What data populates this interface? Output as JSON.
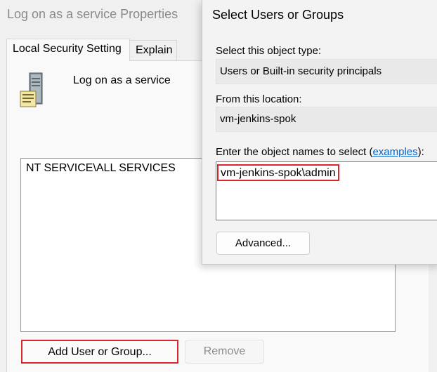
{
  "properties_window": {
    "title": "Log on as a service Properties",
    "tabs": [
      {
        "label": "Local Security Setting",
        "active": true
      },
      {
        "label": "Explain",
        "active": false
      }
    ],
    "policy_icon": "server-policy-icon",
    "policy_name": "Log on as a service",
    "accounts": [
      "NT SERVICE\\ALL SERVICES"
    ],
    "add_button": "Add User or Group...",
    "remove_button": "Remove"
  },
  "select_dialog": {
    "title": "Select Users or Groups",
    "object_type_label": "Select this object type:",
    "object_type_value": "Users or Built-in security principals",
    "location_label": "From this location:",
    "location_value": "vm-jenkins-spok",
    "names_label_prefix": "Enter the object names to select (",
    "names_label_link": "examples",
    "names_label_suffix": "):",
    "names_value": "vm-jenkins-spok\\admin",
    "advanced_button": "Advanced..."
  },
  "colors": {
    "highlight": "#d9262d",
    "link": "#0a64c8"
  }
}
